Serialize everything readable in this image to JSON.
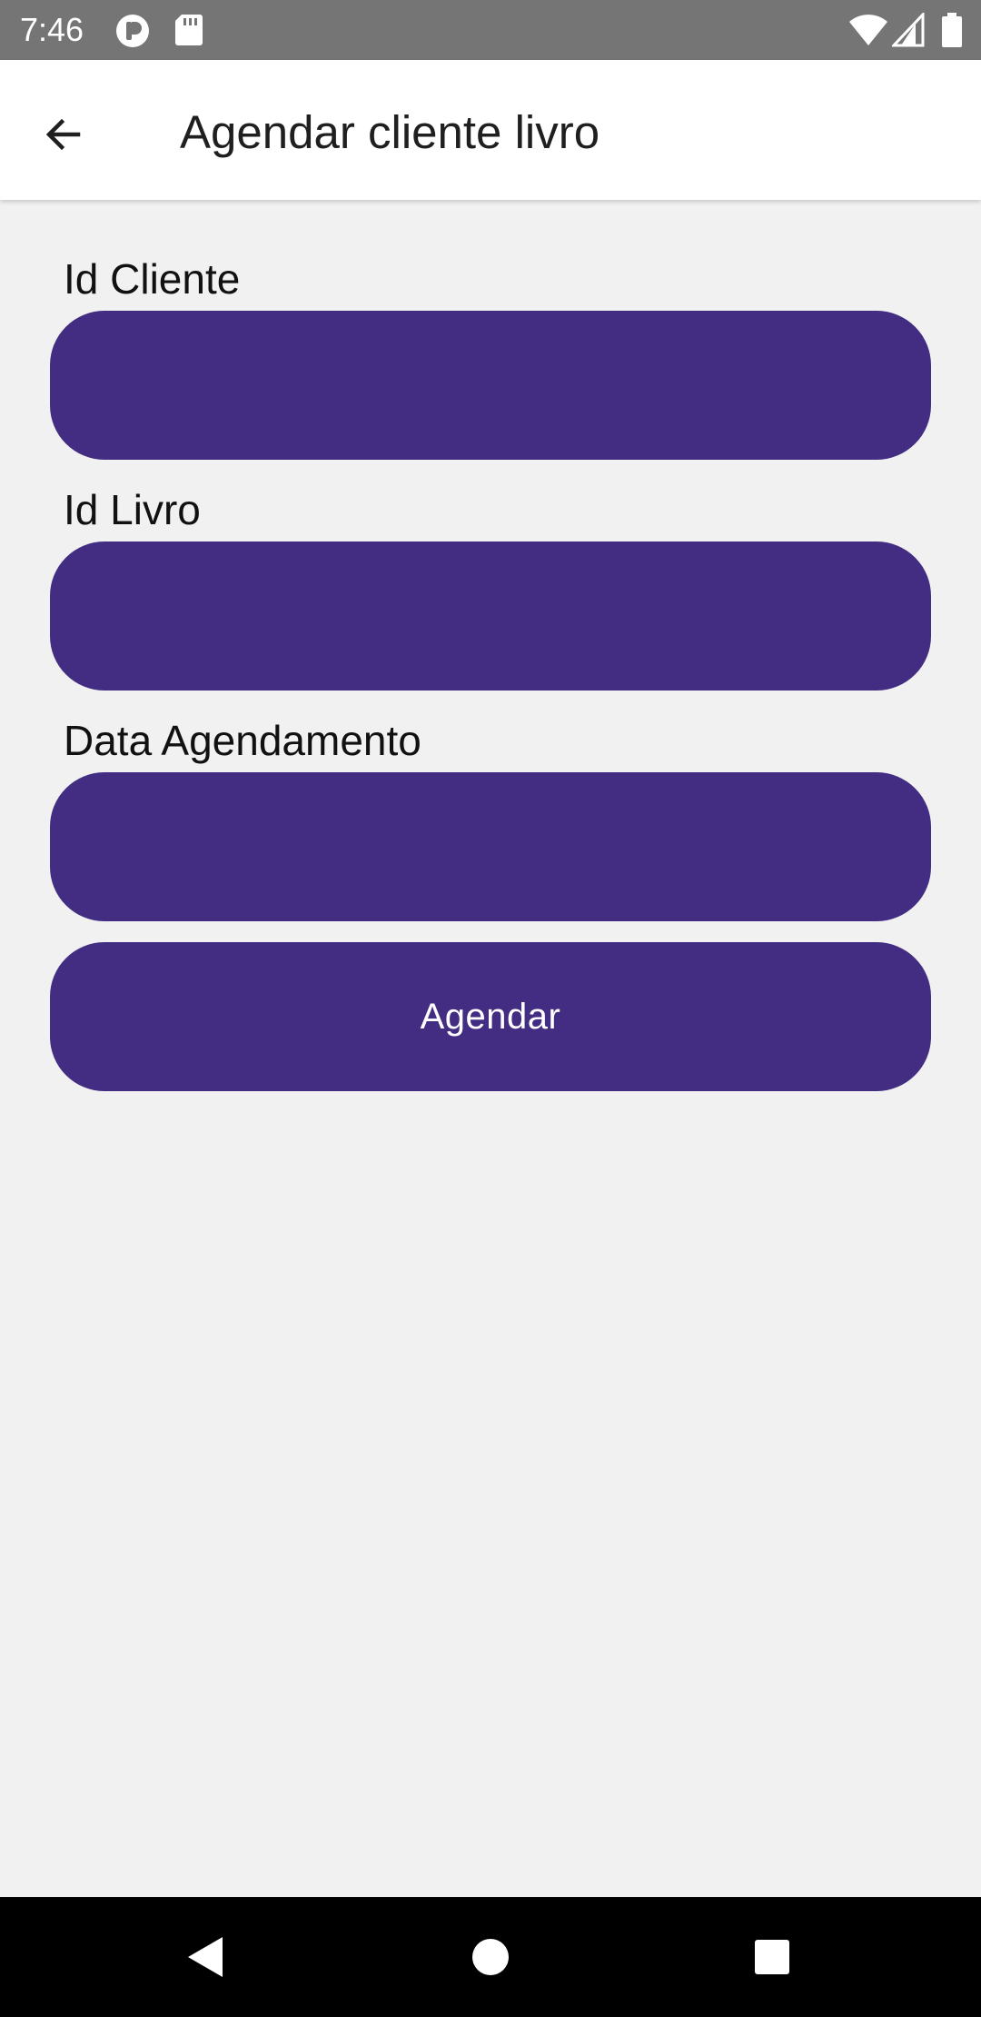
{
  "status_bar": {
    "time": "7:46",
    "icons": [
      "app-notification-icon",
      "sd-card-icon",
      "wifi-icon",
      "signal-icon",
      "battery-icon"
    ]
  },
  "app_bar": {
    "title": "Agendar cliente livro",
    "back_icon": "arrow-left-icon"
  },
  "form": {
    "fields": [
      {
        "label": "Id Cliente",
        "value": ""
      },
      {
        "label": "Id Livro",
        "value": ""
      },
      {
        "label": "Data Agendamento",
        "value": ""
      }
    ],
    "submit_label": "Agendar"
  },
  "nav_bar": {
    "icons": [
      "back-triangle-icon",
      "home-circle-icon",
      "recents-square-icon"
    ]
  },
  "colors": {
    "primary": "#422d82",
    "background": "#f1f1f1",
    "status_bar": "#757575"
  }
}
